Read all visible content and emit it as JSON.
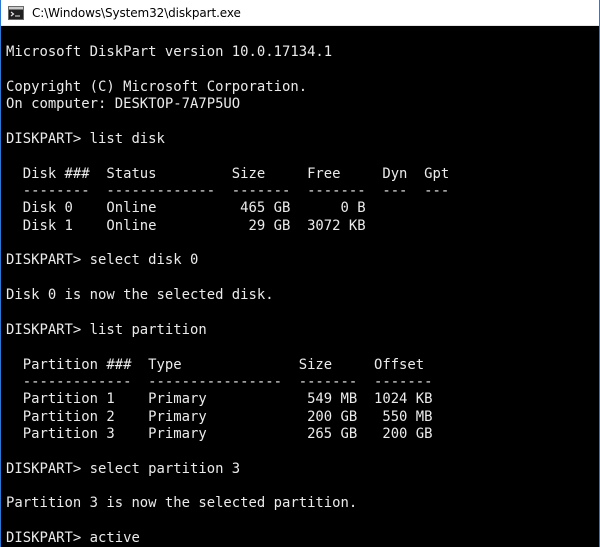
{
  "window": {
    "title": "C:\\Windows\\System32\\diskpart.exe"
  },
  "console": {
    "lines": [
      "",
      "Microsoft DiskPart version 10.0.17134.1",
      "",
      "Copyright (C) Microsoft Corporation.",
      "On computer: DESKTOP-7A7P5UO",
      "",
      "DISKPART> list disk",
      "",
      "  Disk ###  Status         Size     Free     Dyn  Gpt",
      "  --------  -------------  -------  -------  ---  ---",
      "  Disk 0    Online          465 GB      0 B",
      "  Disk 1    Online           29 GB  3072 KB",
      "",
      "DISKPART> select disk 0",
      "",
      "Disk 0 is now the selected disk.",
      "",
      "DISKPART> list partition",
      "",
      "  Partition ###  Type              Size     Offset",
      "  -------------  ----------------  -------  -------",
      "  Partition 1    Primary            549 MB  1024 KB",
      "  Partition 2    Primary            200 GB   550 MB",
      "  Partition 3    Primary            265 GB   200 GB",
      "",
      "DISKPART> select partition 3",
      "",
      "Partition 3 is now the selected partition.",
      "",
      "DISKPART> active"
    ]
  },
  "colors": {
    "console_bg": "#000000",
    "console_text": "#ebebeb",
    "titlebar_bg": "#ffffff",
    "window_border": "#2b78d4"
  },
  "icons": {
    "title_icon": "console-app-icon"
  }
}
